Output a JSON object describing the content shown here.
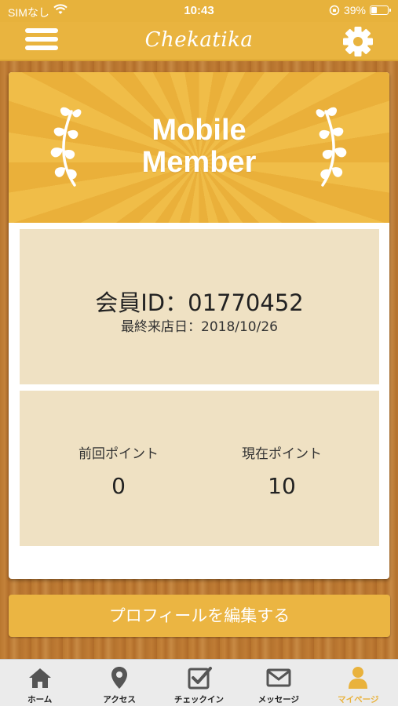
{
  "status_bar": {
    "carrier": "SIMなし",
    "time": "10:43",
    "battery_percent": "39%",
    "battery_level": 0.39
  },
  "nav": {
    "title": "Chekatika",
    "menu_icon": "hamburger-menu-icon",
    "settings_icon": "gear-icon"
  },
  "card": {
    "banner_title_line1": "Mobile",
    "banner_title_line2": "Member",
    "member_id": "会員ID：01770452",
    "last_visit": "最終来店日：2018/10/26",
    "points": {
      "previous_label": "前回ポイント",
      "previous_value": "0",
      "current_label": "現在ポイント",
      "current_value": "10"
    }
  },
  "edit_button_label": "プロフィールを編集する",
  "tab_bar": {
    "tabs": [
      {
        "label": "ホーム",
        "icon": "home-icon"
      },
      {
        "label": "アクセス",
        "icon": "map-pin-icon"
      },
      {
        "label": "チェックイン",
        "icon": "checkin-icon"
      },
      {
        "label": "メッセージ",
        "icon": "mail-icon"
      },
      {
        "label": "マイページ",
        "icon": "user-icon"
      }
    ],
    "active_index": 4
  },
  "colors": {
    "accent": "#e9b43f",
    "panel": "#efe1c3",
    "active_tab": "#e9b23c",
    "inactive_tab": "#555555"
  }
}
